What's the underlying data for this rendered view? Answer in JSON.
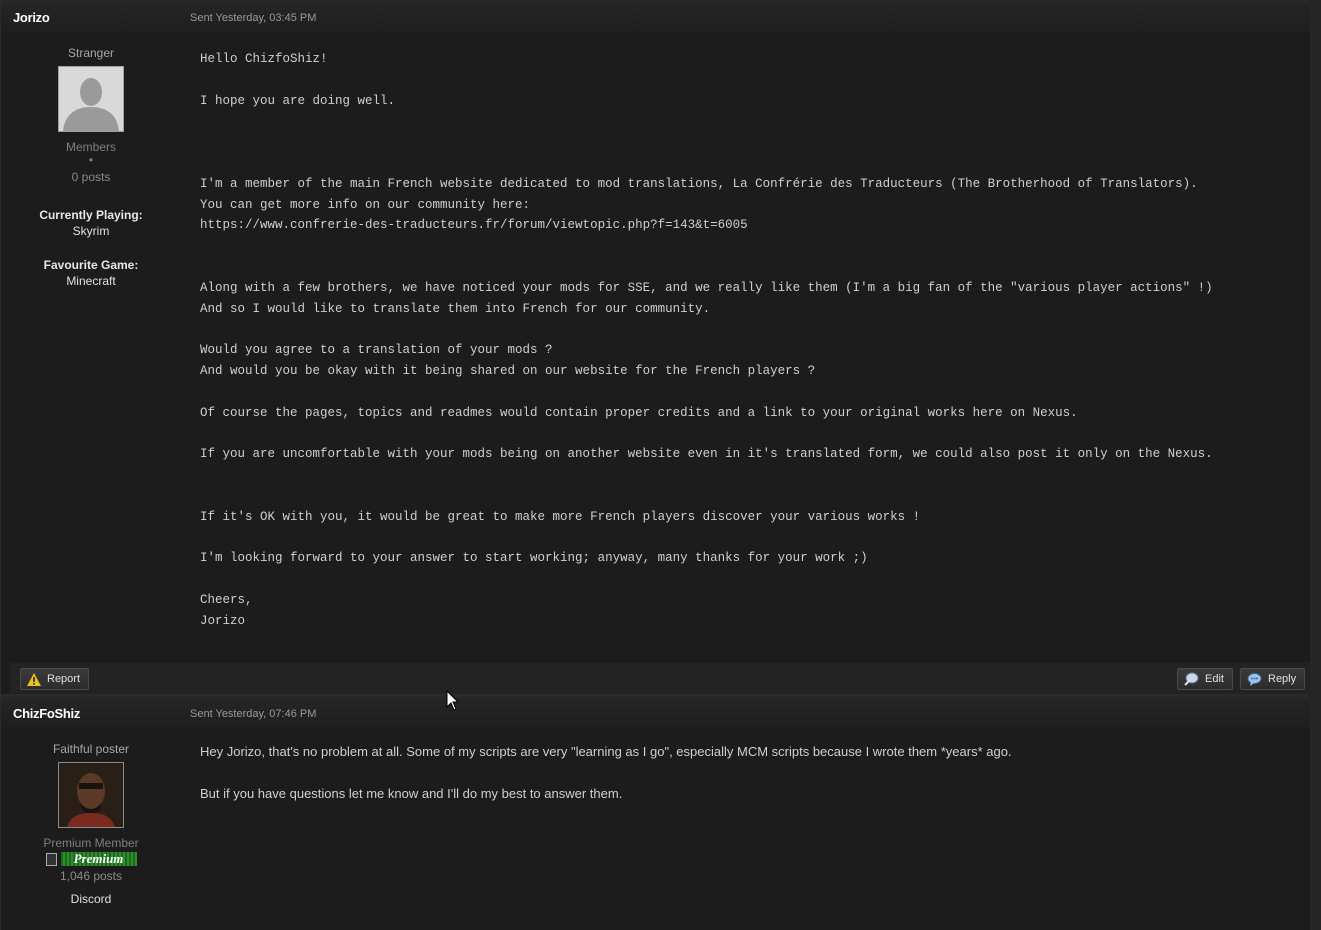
{
  "messages": [
    {
      "author": "Jorizo",
      "sent": "Sent Yesterday, 03:45 PM",
      "rank": "Stranger",
      "group": "Members",
      "dot": "•",
      "posts": "0 posts",
      "info": [
        {
          "label": "Currently Playing:",
          "value": "Skyrim"
        },
        {
          "label": "Favourite Game:",
          "value": "Minecraft"
        }
      ],
      "body": "Hello ChizfoShiz!\n\nI hope you are doing well.\n\n\n\nI'm a member of the main French website dedicated to mod translations, La Confrérie des Traducteurs (The Brotherhood of Translators).\nYou can get more info on our community here:\nhttps://www.confrerie-des-traducteurs.fr/forum/viewtopic.php?f=143&t=6005\n\n\nAlong with a few brothers, we have noticed your mods for SSE, and we really like them (I'm a big fan of the \"various player actions\" !)\nAnd so I would like to translate them into French for our community.\n\nWould you agree to a translation of your mods ?\nAnd would you be okay with it being shared on our website for the French players ?\n\nOf course the pages, topics and readmes would contain proper credits and a link to your original works here on Nexus.\n\nIf you are uncomfortable with your mods being on another website even in it's translated form, we could also post it only on the Nexus.\n\n\nIf it's OK with you, it would be great to make more French players discover your various works !\n\nI'm looking forward to your answer to start working; anyway, many thanks for your work ;)\n\nCheers,\nJorizo"
    },
    {
      "author": "ChizFoShiz",
      "sent": "Sent Yesterday, 07:46 PM",
      "rank": "Faithful poster",
      "group": "Premium Member",
      "badge": "Premium",
      "posts": "1,046 posts",
      "extra": "Discord",
      "body": "Hey Jorizo, that's no problem at all. Some of my scripts are very \"learning as I go\", especially MCM scripts because I wrote them *years* ago.\n\nBut if you have questions let me know and I'll do my best to answer them."
    }
  ],
  "actions": {
    "report": "Report",
    "edit": "Edit",
    "reply": "Reply"
  },
  "icons": {
    "report": "warning-icon",
    "edit": "edit-icon",
    "reply": "reply-icon"
  }
}
